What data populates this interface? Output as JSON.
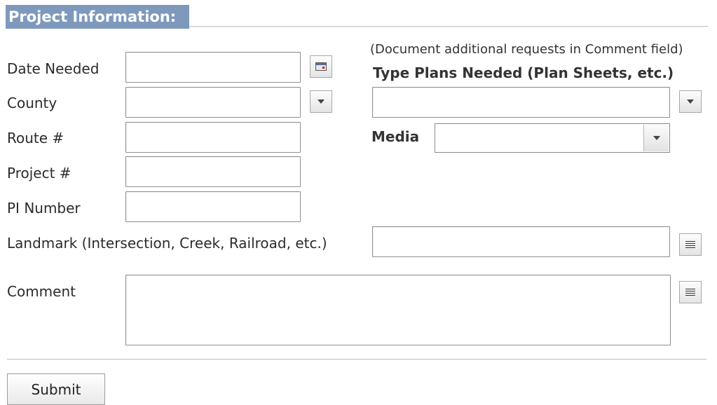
{
  "header": {
    "title": "Project Information:"
  },
  "fields": {
    "date_needed": {
      "label": "Date Needed",
      "value": ""
    },
    "county": {
      "label": "County",
      "value": ""
    },
    "route": {
      "label": "Route #",
      "value": ""
    },
    "project": {
      "label": "Project #",
      "value": ""
    },
    "pi_number": {
      "label": "PI Number",
      "value": ""
    },
    "landmark": {
      "label": "Landmark (Intersection, Creek, Railroad, etc.)",
      "value": ""
    },
    "comment": {
      "label": "Comment",
      "value": ""
    }
  },
  "right": {
    "note": "(Document additional requests in Comment field)",
    "plans_label": "Type Plans Needed (Plan Sheets, etc.)",
    "plans_value": "",
    "media_label": "Media",
    "media_value": ""
  },
  "actions": {
    "submit_label": "Submit"
  },
  "icons": {
    "calendar": "calendar-icon",
    "dropdown": "chevron-down-icon",
    "text_expand": "lines-icon"
  }
}
